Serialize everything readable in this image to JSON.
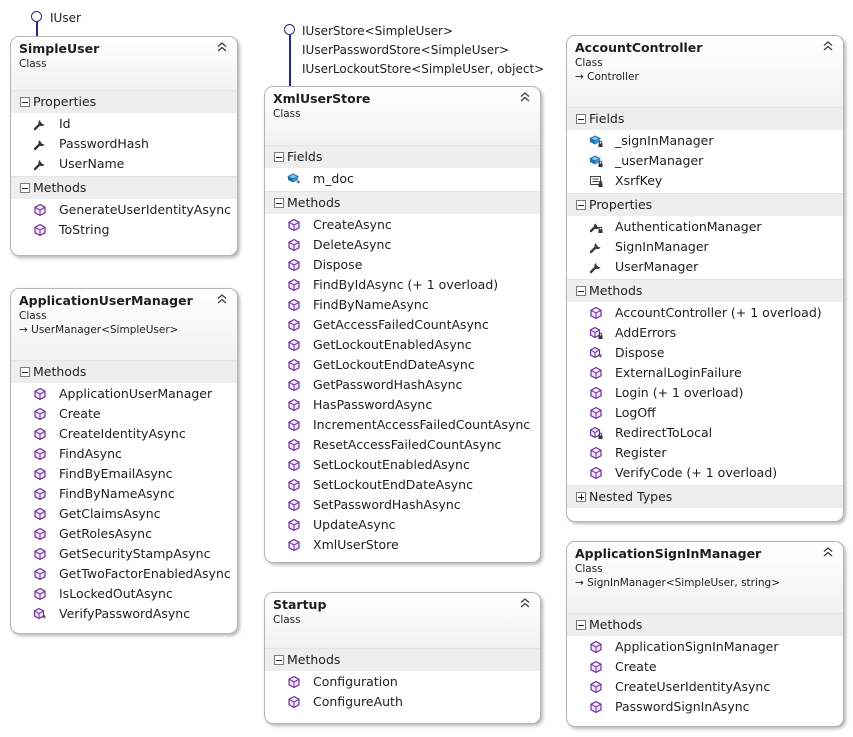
{
  "interfaces": {
    "simple_user": [
      "IUser"
    ],
    "xml_user_store": [
      "IUserStore<SimpleUser>",
      "IUserPasswordStore<SimpleUser>",
      "IUserLockoutStore<SimpleUser, object>"
    ]
  },
  "classes": {
    "simple_user": {
      "name": "SimpleUser",
      "kind": "Class",
      "properties_label": "Properties",
      "properties": [
        "Id",
        "PasswordHash",
        "UserName"
      ],
      "methods_label": "Methods",
      "methods": [
        "GenerateUserIdentityAsync",
        "ToString"
      ]
    },
    "application_user_manager": {
      "name": "ApplicationUserManager",
      "kind": "Class",
      "base": "UserManager<SimpleUser>",
      "methods_label": "Methods",
      "methods": [
        "ApplicationUserManager",
        "Create",
        "CreateIdentityAsync",
        "FindAsync",
        "FindByEmailAsync",
        "FindByNameAsync",
        "GetClaimsAsync",
        "GetRolesAsync",
        "GetSecurityStampAsync",
        "GetTwoFactorEnabledAsync",
        "IsLockedOutAsync",
        "VerifyPasswordAsync"
      ]
    },
    "xml_user_store": {
      "name": "XmlUserStore",
      "kind": "Class",
      "fields_label": "Fields",
      "fields": [
        "m_doc"
      ],
      "methods_label": "Methods",
      "methods": [
        "CreateAsync",
        "DeleteAsync",
        "Dispose",
        "FindByIdAsync (+ 1 overload)",
        "FindByNameAsync",
        "GetAccessFailedCountAsync",
        "GetLockoutEnabledAsync",
        "GetLockoutEndDateAsync",
        "GetPasswordHashAsync",
        "HasPasswordAsync",
        "IncrementAccessFailedCountAsync",
        "ResetAccessFailedCountAsync",
        "SetLockoutEnabledAsync",
        "SetLockoutEndDateAsync",
        "SetPasswordHashAsync",
        "UpdateAsync",
        "XmlUserStore"
      ]
    },
    "startup": {
      "name": "Startup",
      "kind": "Class",
      "methods_label": "Methods",
      "methods": [
        "Configuration",
        "ConfigureAuth"
      ]
    },
    "account_controller": {
      "name": "AccountController",
      "kind": "Class",
      "base": "Controller",
      "fields_label": "Fields",
      "fields": [
        "_signInManager",
        "_userManager",
        "XsrfKey"
      ],
      "properties_label": "Properties",
      "properties": [
        "AuthenticationManager",
        "SignInManager",
        "UserManager"
      ],
      "methods_label": "Methods",
      "methods": [
        "AccountController (+ 1 overload)",
        "AddErrors",
        "Dispose",
        "ExternalLoginFailure",
        "Login (+ 1 overload)",
        "LogOff",
        "RedirectToLocal",
        "Register",
        "VerifyCode (+ 1 overload)"
      ],
      "nested_label": "Nested Types"
    },
    "application_sign_in_manager": {
      "name": "ApplicationSignInManager",
      "kind": "Class",
      "base": "SignInManager<SimpleUser, string>",
      "methods_label": "Methods",
      "methods": [
        "ApplicationSignInManager",
        "Create",
        "CreateUserIdentityAsync",
        "PasswordSignInAsync"
      ]
    }
  },
  "icons": {
    "accent": "#6c2d9c",
    "field": "#1f6fa8",
    "property": "#3a3a3a",
    "interface_lollipop": "#27278a",
    "section_background": "#eeeeee"
  }
}
